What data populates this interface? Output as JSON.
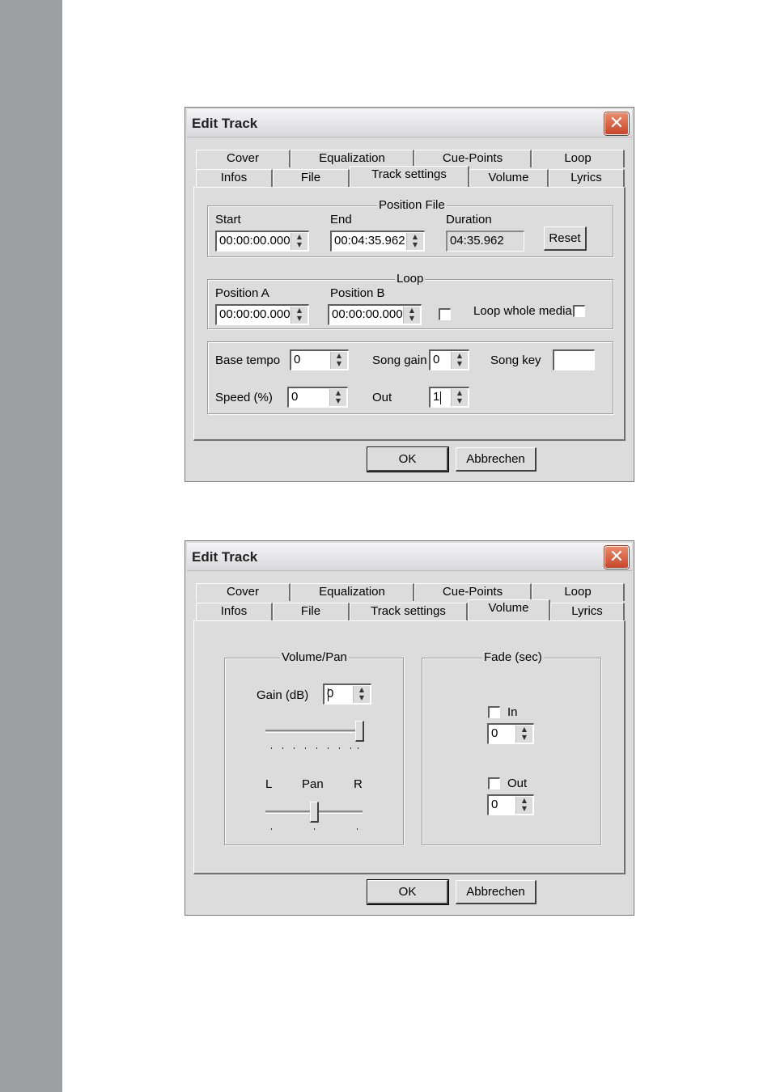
{
  "dialog1": {
    "title": "Edit Track",
    "tabs_row1": [
      "Cover",
      "Equalization",
      "Cue-Points",
      "Loop"
    ],
    "tabs_row2": [
      "Infos",
      "File",
      "Track settings",
      "Volume",
      "Lyrics"
    ],
    "active_tab": "Track settings",
    "position_file": {
      "title": "Position File",
      "start_label": "Start",
      "start_value": "00:00:00.000",
      "end_label": "End",
      "end_value": "00:04:35.962",
      "duration_label": "Duration",
      "duration_value": "04:35.962",
      "reset_label": "Reset"
    },
    "loop": {
      "title": "Loop",
      "pos_a_label": "Position A",
      "pos_a_value": "00:00:00.000",
      "pos_b_label": "Position B",
      "pos_b_value": "00:00:00.000",
      "loop_whole_label": "Loop whole media"
    },
    "tempo": {
      "base_tempo_label": "Base tempo",
      "base_tempo_value": "0",
      "song_gain_label": "Song gain",
      "song_gain_value": "0",
      "song_key_label": "Song key",
      "song_key_value": "",
      "speed_label": "Speed (%)",
      "speed_value": "0",
      "out_label": "Out",
      "out_value": "1"
    },
    "ok_label": "OK",
    "cancel_label": "Abbrechen"
  },
  "dialog2": {
    "title": "Edit Track",
    "tabs_row1": [
      "Cover",
      "Equalization",
      "Cue-Points",
      "Loop"
    ],
    "tabs_row2": [
      "Infos",
      "File",
      "Track settings",
      "Volume",
      "Lyrics"
    ],
    "active_tab": "Volume",
    "volume_pan": {
      "title": "Volume/Pan",
      "gain_label": "Gain (dB)",
      "gain_value": "0",
      "gain_level": 1.0,
      "pan_left": "L",
      "pan_label": "Pan",
      "pan_right": "R",
      "pan_level": 0.5
    },
    "fade": {
      "title": "Fade (sec)",
      "in_label": "In",
      "in_value": "0",
      "out_label": "Out",
      "out_value": "0"
    },
    "ok_label": "OK",
    "cancel_label": "Abbrechen"
  },
  "icons": {
    "close": "close-icon",
    "spin": "spin-arrows-icon"
  }
}
